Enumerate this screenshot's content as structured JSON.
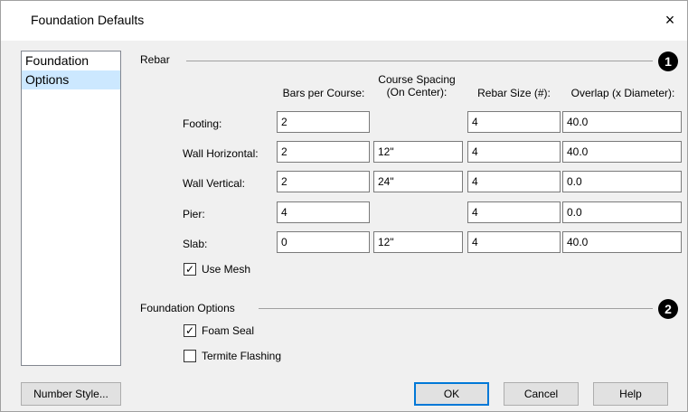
{
  "window": {
    "title": "Foundation Defaults",
    "close_glyph": "×"
  },
  "sidebar": {
    "items": [
      {
        "label": "Foundation",
        "selected": false
      },
      {
        "label": "Options",
        "selected": true
      }
    ]
  },
  "rebar": {
    "section_label": "Rebar",
    "badge": "1",
    "columns": {
      "bars_per_course": "Bars per Course:",
      "course_spacing": "Course Spacing (On Center):",
      "rebar_size": "Rebar Size (#):",
      "overlap": "Overlap (x Diameter):"
    },
    "rows": {
      "footing": {
        "label": "Footing:",
        "bars": "2",
        "spacing": null,
        "size": "4",
        "overlap": "40.0"
      },
      "wall_horizontal": {
        "label": "Wall Horizontal:",
        "bars": "2",
        "spacing": "12\"",
        "size": "4",
        "overlap": "40.0"
      },
      "wall_vertical": {
        "label": "Wall Vertical:",
        "bars": "2",
        "spacing": "24\"",
        "size": "4",
        "overlap": "0.0"
      },
      "pier": {
        "label": "Pier:",
        "bars": "4",
        "spacing": null,
        "size": "4",
        "overlap": "0.0"
      },
      "slab": {
        "label": "Slab:",
        "bars": "0",
        "spacing": "12\"",
        "size": "4",
        "overlap": "40.0"
      }
    },
    "use_mesh": {
      "label": "Use Mesh",
      "checked": true
    }
  },
  "foundation_options": {
    "section_label": "Foundation Options",
    "badge": "2",
    "foam_seal": {
      "label": "Foam Seal",
      "checked": true
    },
    "termite_flashing": {
      "label": "Termite Flashing",
      "checked": false
    }
  },
  "buttons": {
    "number_style": "Number Style...",
    "ok": "OK",
    "cancel": "Cancel",
    "help": "Help"
  },
  "colors": {
    "accent": "#0078d7",
    "selection": "#cce8ff",
    "badge": "#000000"
  }
}
